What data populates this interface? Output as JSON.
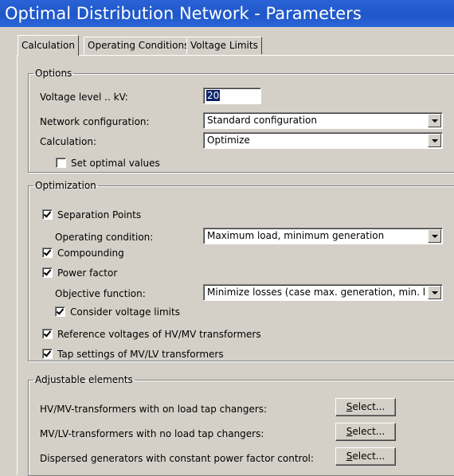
{
  "window": {
    "title": "Optimal Distribution Network - Parameters"
  },
  "tabs": [
    "Calculation",
    "Operating Conditions",
    "Voltage Limits"
  ],
  "options": {
    "legend": "Options",
    "voltage_level_label": "Voltage level .. kV:",
    "voltage_level_value": "20",
    "network_config_label": "Network configuration:",
    "network_config_value": "Standard configuration",
    "calculation_label": "Calculation:",
    "calculation_value": "Optimize",
    "set_optimal_values_label": "Set optimal values",
    "set_optimal_values_checked": false
  },
  "optimization": {
    "legend": "Optimization",
    "separation_points_label": "Separation Points",
    "separation_points_checked": true,
    "operating_condition_label": "Operating condition:",
    "operating_condition_value": "Maximum load, minimum generation",
    "compounding_label": "Compounding",
    "compounding_checked": true,
    "power_factor_label": "Power factor",
    "power_factor_checked": true,
    "objective_function_label": "Objective function:",
    "objective_function_value": "Minimize losses (case max. generation, min. load)",
    "consider_voltage_limits_label": "Consider voltage limits",
    "consider_voltage_limits_checked": true,
    "reference_voltages_label": "Reference voltages of HV/MV transformers",
    "reference_voltages_checked": true,
    "tap_settings_label": "Tap settings of MV/LV transformers",
    "tap_settings_checked": true
  },
  "adjustable": {
    "legend": "Adjustable elements",
    "rows": [
      {
        "label": "HV/MV-transformers with on load tap changers:",
        "button_mnemonic": "S",
        "button_rest": "elect..."
      },
      {
        "label": "MV/LV-transformers with no load tap changers:",
        "button_mnemonic": "S",
        "button_rest": "elect..."
      },
      {
        "label": "Dispersed generators with constant power factor control:",
        "button_mnemonic": "S",
        "button_rest": "elect..."
      }
    ]
  }
}
